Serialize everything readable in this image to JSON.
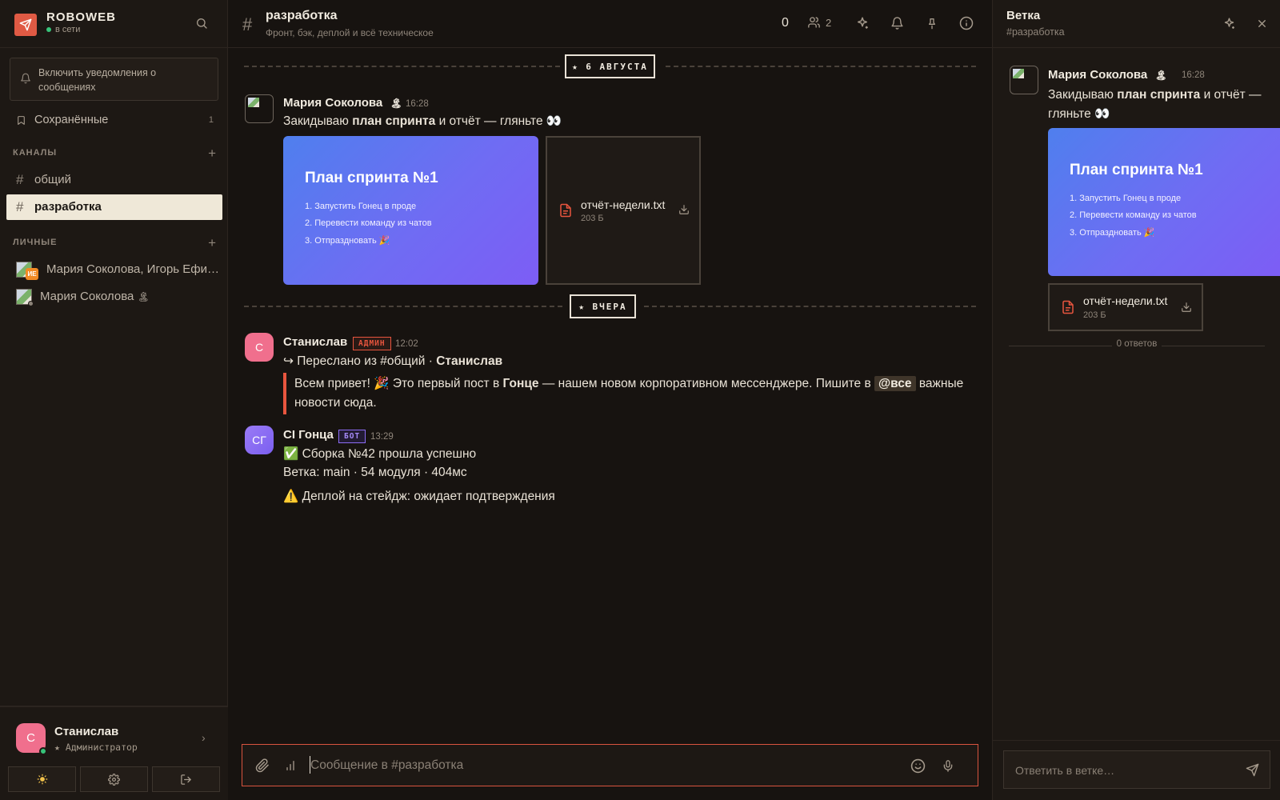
{
  "app": {
    "name": "ROBOWEB",
    "status": "в сети"
  },
  "sidebar": {
    "notify_text": "Включить уведомления о сообщениях",
    "saved": {
      "label": "Сохранённые",
      "count": "1"
    },
    "channels_header": "КАНАЛЫ",
    "channels": [
      {
        "label": "общий",
        "active": false
      },
      {
        "label": "разработка",
        "active": true
      }
    ],
    "personal_header": "ЛИЧНЫЕ",
    "dms": [
      {
        "label": "Мария Соколова, Игорь Ефи…",
        "badge": "ИЕ"
      },
      {
        "label": "Мария Соколова",
        "emoji": "🏝"
      }
    ],
    "user": {
      "initial": "С",
      "name": "Станислав",
      "role": "★ Администратор"
    }
  },
  "channel": {
    "title": "разработка",
    "subtitle": "Фронт, бэк, деплой и всё техническое",
    "count": "0",
    "members": "2"
  },
  "separators": [
    {
      "label": "★ 6 АВГУСТА"
    },
    {
      "label": "★ ВЧЕРА"
    }
  ],
  "messages": {
    "m1": {
      "author": "Мария Соколова",
      "emoji": "🏝",
      "time": "16:28",
      "text_pre": "Закидываю ",
      "text_bold": "план спринта",
      "text_post": " и отчёт — гляньте 👀",
      "card": {
        "title": "План спринта №1",
        "items": [
          "1. Запустить Гонец в проде",
          "2. Перевести команду из чатов",
          "3. Отпраздновать 🎉"
        ]
      },
      "file": {
        "name": "отчёт-недели.txt",
        "size": "203 Б"
      }
    },
    "m2": {
      "initial": "С",
      "author": "Станислав",
      "badge": "АДМИН",
      "time": "12:02",
      "forward_pre": "↪ Переслано из #общий · ",
      "forward_author": "Станислав",
      "quote_1a": "Всем привет! 🎉 Это первый пост в ",
      "quote_1b": "Гонце",
      "quote_1c": " — нашем новом корпоративном мессенджере. Пишите в ",
      "mention": "@все",
      "quote_1d": " важные",
      "quote_2": "новости сюда."
    },
    "m3": {
      "initial": "СГ",
      "author": "CI Гонца",
      "badge": "БОТ",
      "time": "13:29",
      "line1": "✅ Сборка №42 прошла успешно",
      "line2": "Ветка: main · 54 модуля · 404мс",
      "line3": "⚠️ Деплой на стейдж: ожидает подтверждения"
    }
  },
  "composer": {
    "placeholder": "Сообщение в #разработка"
  },
  "thread": {
    "title": "Ветка",
    "subtitle": "#разработка",
    "replies": "0 ответов",
    "reply_placeholder": "Ответить в ветке…"
  },
  "colors": {
    "accent": "#e05a44",
    "online": "#37c47a",
    "admin_badge": "#e8553e",
    "bot_badge": "#8c6cf5",
    "card_gradient_start": "#4f7fee",
    "card_gradient_end": "#7d5df5"
  },
  "icons": {
    "brand": "send-icon",
    "search": "search-icon",
    "bell": "bell-icon",
    "bookmark": "bookmark-icon",
    "members": "users-icon",
    "sparkle": "sparkle-icon",
    "pin": "pin-icon",
    "info": "info-icon",
    "close": "close-icon",
    "attach": "paperclip-icon",
    "poll": "chart-icon",
    "emoji": "smile-icon",
    "mic": "mic-icon",
    "send": "send-icon",
    "theme": "sun-icon",
    "settings": "gear-icon",
    "logout": "logout-icon",
    "file": "file-icon",
    "download": "download-icon"
  }
}
